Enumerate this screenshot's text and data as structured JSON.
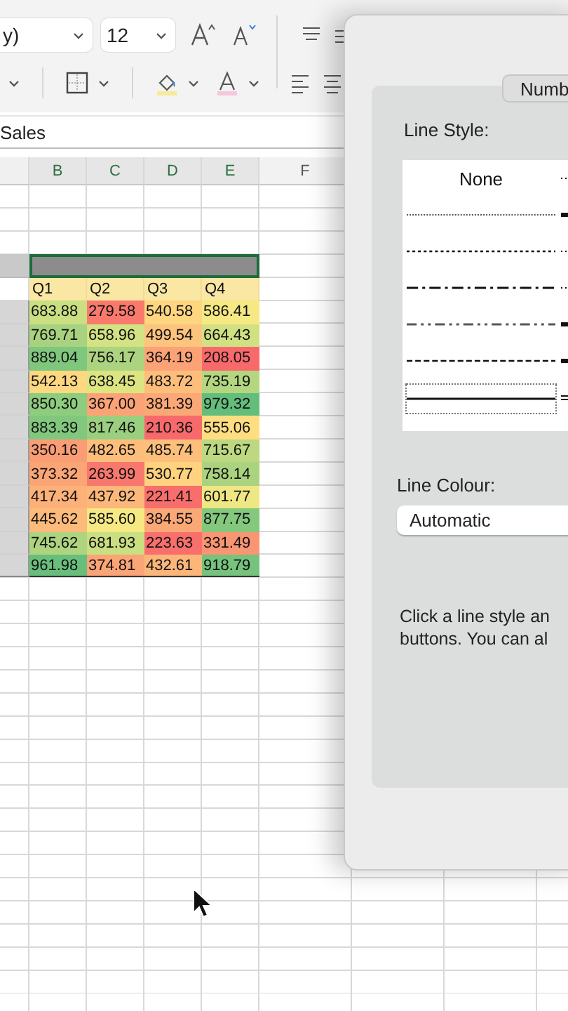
{
  "ribbon": {
    "font_name": "y)",
    "font_size": "12"
  },
  "formula_bar": {
    "value": "Sales"
  },
  "sheet": {
    "column_letters": [
      "B",
      "C",
      "D",
      "E",
      "F"
    ],
    "headers": [
      "Q1",
      "Q2",
      "Q3",
      "Q4"
    ],
    "rows": [
      [
        {
          "text": "683.88",
          "color": "#c9df81"
        },
        {
          "text": "279.58",
          "color": "#f97a6d"
        },
        {
          "text": "540.58",
          "color": "#fed680"
        },
        {
          "text": "586.41",
          "color": "#f6e883"
        }
      ],
      [
        {
          "text": "769.71",
          "color": "#a8d27f"
        },
        {
          "text": "658.96",
          "color": "#d3e282"
        },
        {
          "text": "499.54",
          "color": "#fdc47d"
        },
        {
          "text": "664.43",
          "color": "#d1e182"
        }
      ],
      [
        {
          "text": "889.04",
          "color": "#7fc77d"
        },
        {
          "text": "756.17",
          "color": "#acd380"
        },
        {
          "text": "364.19",
          "color": "#fba276"
        },
        {
          "text": "208.05",
          "color": "#f8696b"
        }
      ],
      [
        {
          "text": "542.13",
          "color": "#fed880"
        },
        {
          "text": "638.45",
          "color": "#dce582"
        },
        {
          "text": "483.72",
          "color": "#fdbe7c"
        },
        {
          "text": "735.19",
          "color": "#b4d680"
        }
      ],
      [
        {
          "text": "850.30",
          "color": "#8ecc7e"
        },
        {
          "text": "367.00",
          "color": "#fba376"
        },
        {
          "text": "381.39",
          "color": "#fba877"
        },
        {
          "text": "979.32",
          "color": "#63be7b"
        }
      ],
      [
        {
          "text": "883.39",
          "color": "#81c77d"
        },
        {
          "text": "817.46",
          "color": "#9acf7f"
        },
        {
          "text": "210.36",
          "color": "#f8696b"
        },
        {
          "text": "555.06",
          "color": "#fede81"
        }
      ],
      [
        {
          "text": "350.16",
          "color": "#fa9d75"
        },
        {
          "text": "482.65",
          "color": "#fdbe7c"
        },
        {
          "text": "485.74",
          "color": "#fdbf7c"
        },
        {
          "text": "715.67",
          "color": "#bcd880"
        }
      ],
      [
        {
          "text": "373.32",
          "color": "#fba576"
        },
        {
          "text": "263.99",
          "color": "#f9786d"
        },
        {
          "text": "530.77",
          "color": "#fed27f"
        },
        {
          "text": "758.14",
          "color": "#abd37f"
        }
      ],
      [
        {
          "text": "417.34",
          "color": "#fcb179"
        },
        {
          "text": "437.92",
          "color": "#fcb87a"
        },
        {
          "text": "221.41",
          "color": "#f86e6c"
        },
        {
          "text": "601.77",
          "color": "#eee783"
        }
      ],
      [
        {
          "text": "445.62",
          "color": "#fcba7b"
        },
        {
          "text": "585.60",
          "color": "#f6e883"
        },
        {
          "text": "384.55",
          "color": "#fba877"
        },
        {
          "text": "877.75",
          "color": "#83c87d"
        }
      ],
      [
        {
          "text": "745.62",
          "color": "#afd480"
        },
        {
          "text": "681.93",
          "color": "#cadf81"
        },
        {
          "text": "223.63",
          "color": "#f86f6c"
        },
        {
          "text": "331.49",
          "color": "#fa9573"
        }
      ],
      [
        {
          "text": "961.98",
          "color": "#68bf7c"
        },
        {
          "text": "374.81",
          "color": "#fba576"
        },
        {
          "text": "432.61",
          "color": "#fcb67a"
        },
        {
          "text": "918.79",
          "color": "#75c37d"
        }
      ]
    ]
  },
  "dialog": {
    "tab": "Numb",
    "line_style_label": "Line Style:",
    "line_styles": [
      {
        "kind": "none",
        "label": "None",
        "selected": false
      },
      {
        "kind": "hair",
        "selected": false
      },
      {
        "kind": "dotted",
        "selected": false
      },
      {
        "kind": "dash-dot",
        "selected": false
      },
      {
        "kind": "dash-dot-dot",
        "selected": false
      },
      {
        "kind": "dashed",
        "selected": false
      },
      {
        "kind": "solid",
        "selected": true
      }
    ],
    "line_colour_label": "Line Colour:",
    "line_colour": "Automatic",
    "help_lines": [
      "Click a line style an",
      "buttons. You can al"
    ]
  }
}
